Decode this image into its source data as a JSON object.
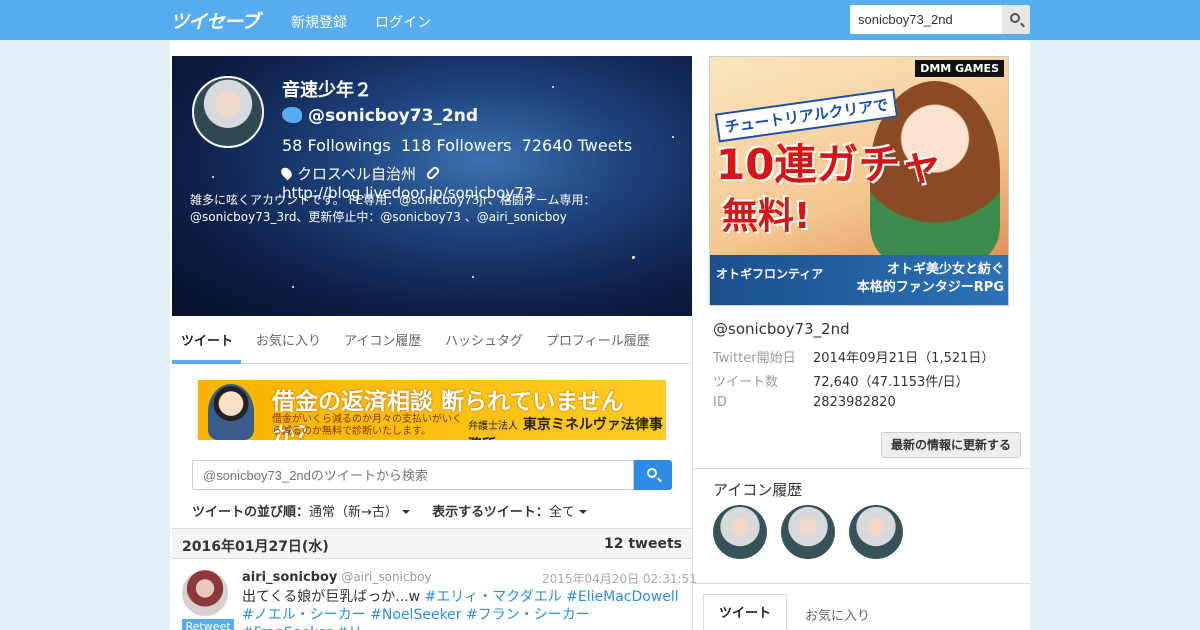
{
  "topbar": {
    "logo": "ツイセーブ",
    "nav_signup": "新規登録",
    "nav_login": "ログイン",
    "search_value": "sonicboy73_2nd"
  },
  "profile": {
    "name": "音速少年２",
    "handle": "@sonicboy73_2nd",
    "followings": "58",
    "followings_label": "Followings",
    "followers": "118",
    "followers_label": "Followers",
    "tweets": "72640",
    "tweets_label": "Tweets",
    "location": "クロスベル自治州",
    "url": "http://blog.livedoor.jp/sonicboy73",
    "bio": "雑多に呟くアカウントです。 FE専用：@sonicboy73jr、格闘ゲーム専用：@sonicboy73_3rd、更新停止中：@sonicboy73 、@airi_sonicboy"
  },
  "tabs": [
    "ツイート",
    "お気に入り",
    "アイコン履歴",
    "ハッシュタグ",
    "プロフィール履歴"
  ],
  "ad_top": {
    "headline": "借金の返済相談 断られていませんか？",
    "sub": "借金がいくら減るのか月々の支払いがいくら減るのか無料で診断いたします。",
    "firm_prefix": "弁護士法人",
    "firm": "東京ミネルヴァ法律事務所"
  },
  "tweet_search": {
    "placeholder": "@sonicboy73_2ndのツイートから検索"
  },
  "sort": {
    "order_label": "ツイートの並び順：",
    "order_value": "通常（新→古）",
    "show_label": "表示するツイート：",
    "show_value": "全て"
  },
  "date_group": {
    "date": "2016年01月27日(水)",
    "count": "12 tweets"
  },
  "tweet": {
    "user": "airi_sonicboy",
    "handle": "@airi_sonicboy",
    "time": "2015年04月20日 02:31:51",
    "text": "出てくる娘が巨乳ばっか...w ",
    "tags": "#エリィ・マクダエル #ElieMacDowell #ノエル・シーカー #NoelSeeker #フラン・シーカー #FranSeeker #リ",
    "badge": "Retweet"
  },
  "ad_side": {
    "brand": "DMM GAMES",
    "line1": "チュートリアルクリアで",
    "line2": "10連ガチャ",
    "line3": "無料!",
    "game": "オトギフロンティア",
    "tag1": "オトギ美少女と紡ぐ",
    "tag2": "本格的ファンタジーRPG"
  },
  "side_info": {
    "handle": "@sonicboy73_2nd",
    "start_label": "Twitter開始日",
    "start_value": "2014年09月21日（1,521日）",
    "count_label": "ツイート数",
    "count_value": "72,640（47.1153件/日）",
    "id_label": "ID",
    "id_value": "2823982820",
    "refresh": "最新の情報に更新する"
  },
  "icon_history": {
    "title": "アイコン履歴"
  },
  "side_tabs": [
    "ツイート",
    "お気に入り"
  ],
  "colors": {
    "accent": "#55acee",
    "link": "#2d8ce6"
  }
}
